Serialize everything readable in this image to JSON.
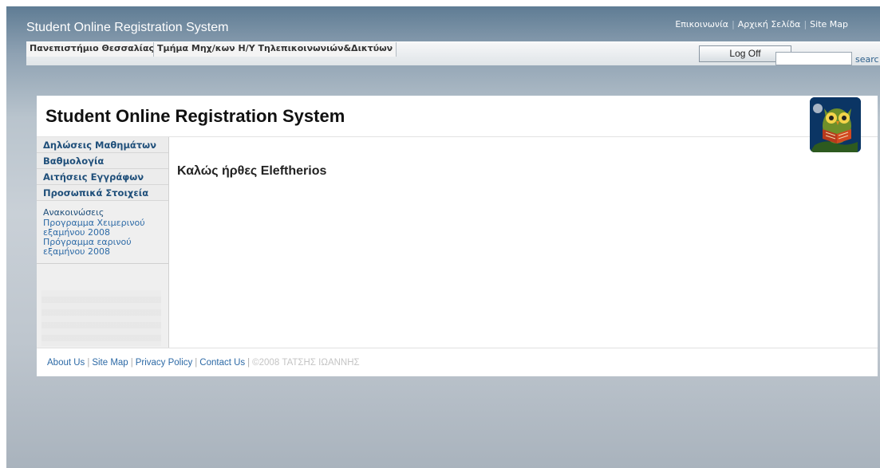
{
  "app": {
    "title": "Student Online Registration System",
    "top_links": [
      "Επικοινωνία",
      "Αρχική Σελίδα",
      "Site Map"
    ],
    "tabs": [
      "Πανεπιστήμιο Θεσσαλίας",
      "Τμήμα Μηχ/κων Η/Υ Τηλεπικοινωνιών&Δικτύων"
    ],
    "logoff_label": "Log Off",
    "search": {
      "value": "",
      "label": "searc"
    }
  },
  "main": {
    "title": "Student Online Registration System",
    "welcome": "Καλώς ήρθες Eleftherios"
  },
  "sidebar": {
    "items": [
      {
        "label": "Δηλώσεις Μαθημάτων"
      },
      {
        "label": "Βαθμολογία"
      },
      {
        "label": "Αιτήσεις Εγγράφων"
      },
      {
        "label": "Προσωπικά Στοιχεία"
      }
    ],
    "announcements": {
      "title": "Ανακοινώσεις",
      "links": [
        "Προγραμμα Χειμερινού εξαμήνου 2008",
        "Πρόγραμμα εαρινού εξαμήνου 2008"
      ]
    }
  },
  "footer": {
    "links": [
      "About Us",
      "Site Map",
      "Privacy Policy",
      "Contact Us"
    ],
    "copyright": "©2008 ΤΑΤΣΗΣ ΙΩΑΝΝΗΣ"
  },
  "colors": {
    "accent": "#1f4f7a",
    "link": "#2d6aa6",
    "header_bg": "#5f7c94"
  },
  "icons": {
    "logo": "owl-reading-book-icon"
  }
}
